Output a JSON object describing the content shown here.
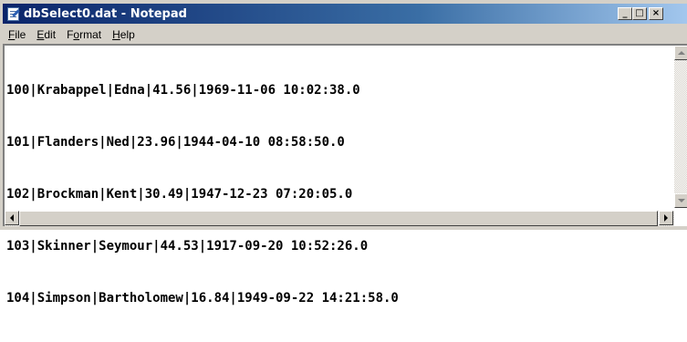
{
  "window": {
    "title": "dbSelect0.dat - Notepad",
    "caption_buttons": {
      "minimize": "_",
      "maximize": "□",
      "close": "×"
    }
  },
  "menu": [
    {
      "label": "File",
      "accel": "F",
      "rest": "ile"
    },
    {
      "label": "Edit",
      "accel": "E",
      "rest": "dit"
    },
    {
      "label": "Format",
      "pre": "F",
      "accel": "o",
      "rest": "rmat"
    },
    {
      "label": "Help",
      "accel": "H",
      "rest": "elp"
    }
  ],
  "document": {
    "lines": [
      "100|Krabappel|Edna|41.56|1969-11-06 10:02:38.0",
      "101|Flanders|Ned|23.96|1944-04-10 08:58:50.0",
      "102|Brockman|Kent|30.49|1947-12-23 07:20:05.0",
      "103|Skinner|Seymour|44.53|1917-09-20 10:52:26.0",
      "104|Simpson|Bartholomew|16.84|1949-09-22 14:21:58.0"
    ]
  },
  "icons": {
    "app": "notepad-icon",
    "scroll_up": "scroll-up-arrow-icon",
    "scroll_down": "scroll-down-arrow-icon",
    "scroll_left": "scroll-left-arrow-icon",
    "scroll_right": "scroll-right-arrow-icon"
  },
  "colors": {
    "title_start": "#0a246a",
    "title_end": "#a6caf0",
    "chrome": "#d4d0c8",
    "editor_bg": "#ffffff"
  }
}
